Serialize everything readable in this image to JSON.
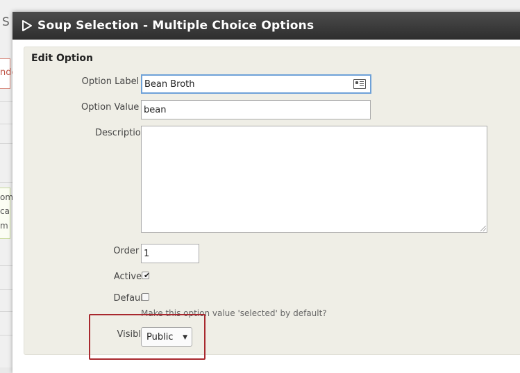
{
  "background": {
    "title_fragment": "S",
    "orange_fragment": "nde",
    "green_lines": [
      "om",
      "ca",
      "m"
    ]
  },
  "modal": {
    "title": "Soup Selection - Multiple Choice Options",
    "section_title": "Edit Option"
  },
  "form": {
    "option_label": {
      "label": "Option Label",
      "value": "Bean Broth",
      "required": "*"
    },
    "option_value": {
      "label": "Option Value",
      "value": "bean",
      "required": "*"
    },
    "description": {
      "label": "Description",
      "value": ""
    },
    "order": {
      "label": "Order",
      "value": "1",
      "required": "*"
    },
    "active": {
      "label": "Active?",
      "checked": true
    },
    "default": {
      "label": "Default",
      "checked": false,
      "help": "Make this option value 'selected' by default?"
    },
    "visible": {
      "label": "Visible",
      "selected": "Public"
    }
  },
  "colors": {
    "title_bar": "#3a3a3a",
    "panel": "#efeee6",
    "required": "#a1232e",
    "highlight": "#a8282e",
    "focus": "#6ea1d8"
  }
}
